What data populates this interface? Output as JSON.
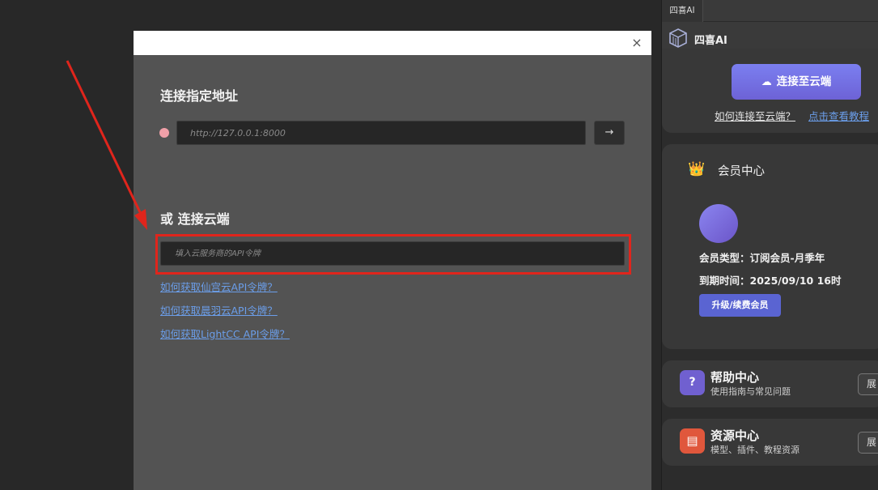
{
  "dialog": {
    "close_glyph": "×",
    "local_title": "连接指定地址",
    "url_placeholder": "http://127.0.0.1:8000",
    "go_glyph": "→",
    "cloud_title": "或 连接云端",
    "token_placeholder": "填入云服务商的API令牌",
    "links": [
      "如何获取仙宫云API令牌？",
      "如何获取晨羽云API令牌？",
      "如何获取LightCC API令牌？"
    ]
  },
  "panel": {
    "tab_label": "四喜AI",
    "brand_name": "四喜AI",
    "brand_icon": "cube-logo-icon",
    "cloud": {
      "button_label": "连接至云端",
      "button_icon": "cloud-icon",
      "question": "如何连接至云端？",
      "tutorial": "点击查看教程"
    },
    "member": {
      "icon": "crown-icon",
      "title": "会员中心",
      "type_line": "会员类型：订阅会员-月季年",
      "expire_line": "到期时间：2025/09/10 16时",
      "upgrade_label": "升级/续费会员"
    },
    "help": {
      "icon": "question-icon",
      "icon_glyph": "?",
      "title": "帮助中心",
      "subtitle": "使用指南与常见问题",
      "expand_label": "展"
    },
    "resource": {
      "icon": "books-icon",
      "title": "资源中心",
      "subtitle": "模型、插件、教程资源",
      "expand_label": "展"
    }
  },
  "colors": {
    "accent": "#6d6fe0",
    "link": "#6b9eea",
    "annotation_red": "#e0251c",
    "status_dot": "#f0a0a8"
  }
}
